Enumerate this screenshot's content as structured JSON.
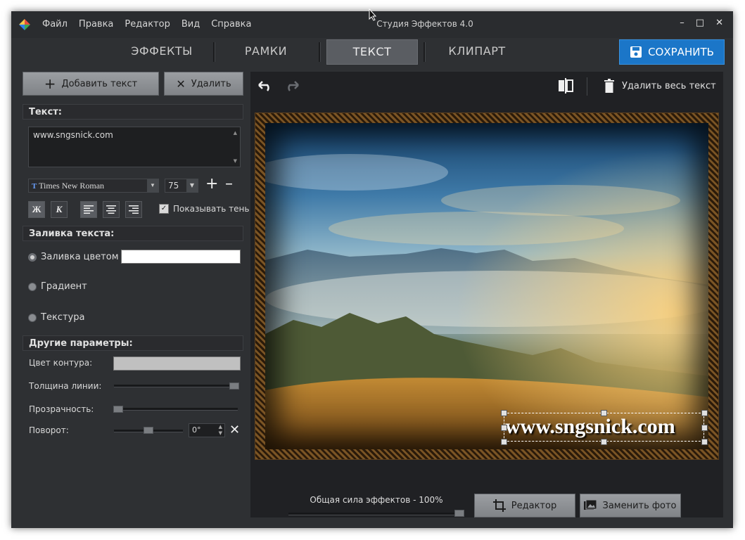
{
  "window": {
    "title": "Студия Эффектов 4.0",
    "menu": [
      "Файл",
      "Правка",
      "Редактор",
      "Вид",
      "Справка"
    ]
  },
  "tabs": [
    "ЭФФЕКТЫ",
    "РАМКИ",
    "ТЕКСТ",
    "КЛИПАРТ"
  ],
  "active_tab": "ТЕКСТ",
  "save_label": "СОХРАНИТЬ",
  "left": {
    "add_text_label": "Добавить текст",
    "delete_label": "Удалить",
    "text_section": "Текст:",
    "text_value": "www.sngsnick.com",
    "font_name": "Times New Roman",
    "font_size": "75",
    "bold_label": "Ж",
    "italic_label": "К",
    "show_shadow_label": "Показывать тень",
    "fill_section": "Заливка текста:",
    "fill_color_label": "Заливка цветом",
    "gradient_label": "Градиент",
    "texture_label": "Текстура",
    "other_section": "Другие параметры:",
    "outline_color_label": "Цвет контура:",
    "line_width_label": "Толщина линии:",
    "opacity_label": "Прозрачность:",
    "rotation_label": "Поворот:",
    "rotation_value": "0°"
  },
  "canvas": {
    "delete_all_label": "Удалить весь текст",
    "watermark_text": "www.sngsnick.com"
  },
  "bottom": {
    "effect_strength_label": "Общая сила эффектов - 100%",
    "editor_label": "Редактор",
    "replace_photo_label": "Заменить фото"
  },
  "colors": {
    "accent": "#1b76c8",
    "panel": "#2e3033",
    "text_fill": "#ffffff",
    "outline": "#c0c0c0"
  }
}
